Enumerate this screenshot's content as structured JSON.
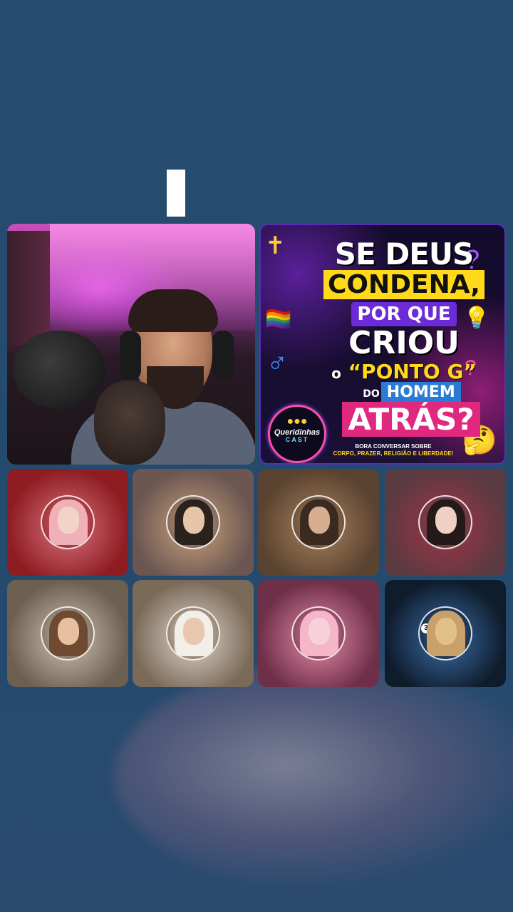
{
  "poster": {
    "line1": "SE DEUS",
    "line2": "CONDENA,",
    "line3": "POR QUE",
    "line4": "CRIOU",
    "line5_prefix": "o",
    "line5": "“PONTO G”",
    "line6_prefix": "DO",
    "line6": "HOMEM",
    "line7": "ATRÁS?",
    "logo_name": "Queridinhas",
    "logo_sub": "CAST",
    "subtitle_line1": "BORA CONVERSAR SOBRE",
    "subtitle_line2": "CORPO, PRAZER, RELIGIÃO E LIBERDADE!"
  },
  "participants": [
    {
      "bg": "#8f1c22",
      "accent": "#d9737f",
      "hair": "#f0b0b8",
      "face": "#f3d2c8"
    },
    {
      "bg": "#6b5652",
      "accent": "#c9a27a",
      "hair": "#2b211d",
      "face": "#e6c5a8"
    },
    {
      "bg": "#5a4330",
      "accent": "#a8805c",
      "hair": "#3a2a20",
      "face": "#d8ae92"
    },
    {
      "bg": "#5c3a42",
      "accent": "#a33346",
      "hair": "#241a1a",
      "face": "#f0cfc4"
    },
    {
      "bg": "#6e6050",
      "accent": "#cfc2b2",
      "hair": "#6e4a30",
      "face": "#e8c0a0"
    },
    {
      "bg": "#7a6a58",
      "accent": "#e0d6cc",
      "hair": "#f1efe8",
      "face": "#e8c6b0"
    },
    {
      "bg": "#6e2f48",
      "accent": "#e48aa8",
      "hair": "#f4b6c8",
      "face": "#f7d0dc"
    },
    {
      "bg": "#0f1c2c",
      "accent": "#3b6ea8",
      "hair": "#c9a06a",
      "face": "#e2c08a"
    }
  ],
  "badge_8": "3",
  "colors": {
    "background": "#244a6e",
    "caret": "#ffffff"
  }
}
